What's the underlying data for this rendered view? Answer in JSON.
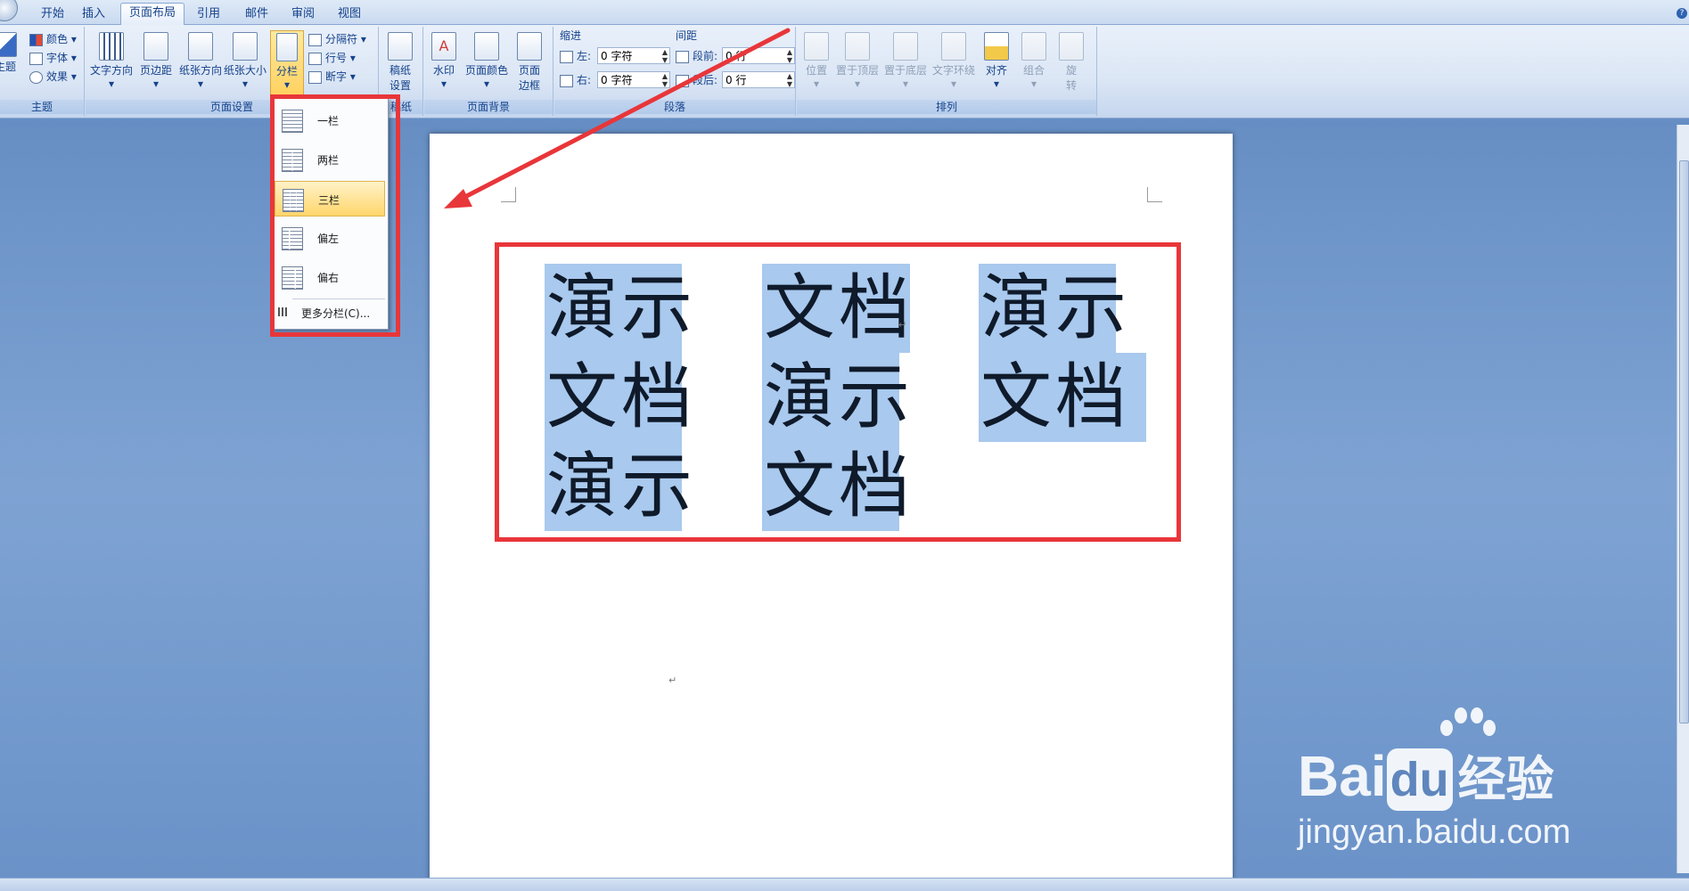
{
  "tabs": [
    {
      "label": "开始"
    },
    {
      "label": "插入"
    },
    {
      "label": "页面布局",
      "active": true
    },
    {
      "label": "引用"
    },
    {
      "label": "邮件"
    },
    {
      "label": "审阅"
    },
    {
      "label": "视图"
    }
  ],
  "help_icon": "question-icon",
  "ribbon": {
    "theme_group": {
      "label": "主题",
      "theme_button": "主题",
      "colors": "颜色",
      "fonts": "字体",
      "effects": "效果"
    },
    "page_setup": {
      "label": "页面设置",
      "text_direction": "文字方向",
      "margins": "页边距",
      "orientation": "纸张方向",
      "size": "纸张大小",
      "columns": "分栏",
      "breaks": "分隔符",
      "line_numbers": "行号",
      "hyphenation": "断字"
    },
    "draft_paper": {
      "label_fragment": "稿纸",
      "button_line1": "稿纸",
      "button_line2": "设置"
    },
    "page_background": {
      "label": "页面背景",
      "watermark": "水印",
      "page_color": "页面颜色",
      "border_line1": "页面",
      "border_line2": "边框"
    },
    "paragraph": {
      "label": "段落",
      "indent_heading": "缩进",
      "spacing_heading": "间距",
      "left_label": "左:",
      "left_value": "0 字符",
      "right_label": "右:",
      "right_value": "0 字符",
      "before_label": "段前:",
      "before_value": "0 行",
      "after_label": "段后:",
      "after_value": "0 行"
    },
    "arrange": {
      "label": "排列",
      "position": "位置",
      "bring_front": "置于顶层",
      "send_back": "置于底层",
      "wrap": "文字环绕",
      "align": "对齐",
      "group": "组合",
      "rotate_line1": "旋",
      "rotate_line2": "转"
    }
  },
  "columns_menu": {
    "items": [
      {
        "label": "一栏"
      },
      {
        "label": "两栏"
      },
      {
        "label": "三栏",
        "highlighted": true
      },
      {
        "label": "偏左"
      },
      {
        "label": "偏右"
      }
    ],
    "more": "更多分栏(C)..."
  },
  "document": {
    "columns": [
      {
        "lines": [
          "演示",
          "文档",
          "演示"
        ]
      },
      {
        "lines": [
          "文档",
          "演示",
          "文档"
        ]
      },
      {
        "lines": [
          "演示",
          "文档"
        ]
      }
    ],
    "para_mark": "↵"
  },
  "watermark": {
    "brand": "Bai",
    "brand2": "du",
    "cn": "经验",
    "url": "jingyan.baidu.com"
  },
  "annotation_color": "#e8363a",
  "selection_color": "#a9c9ee"
}
